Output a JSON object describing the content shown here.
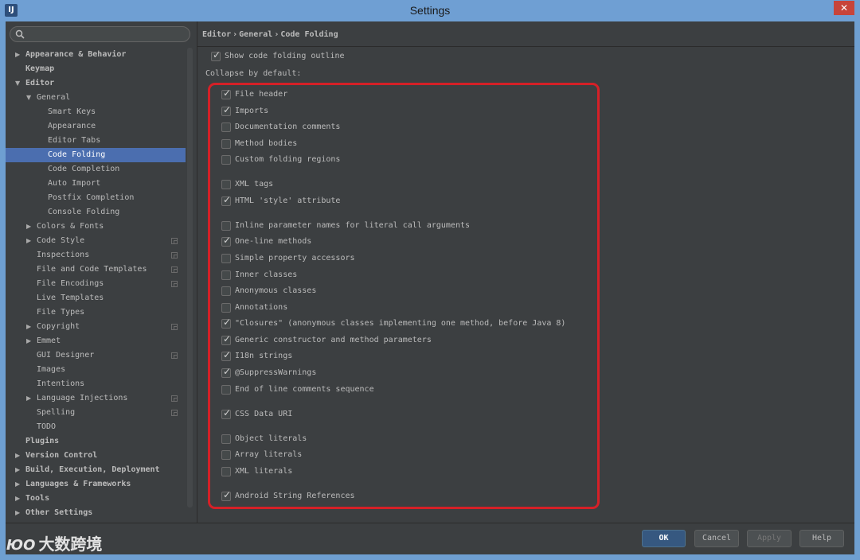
{
  "window": {
    "title": "Settings",
    "app_icon_text": "IJ",
    "close_glyph": "✕"
  },
  "search": {
    "placeholder": "",
    "value": ""
  },
  "sidebar": {
    "items": [
      {
        "label": "Appearance & Behavior",
        "level": 0,
        "arrow": "▶",
        "bold": true,
        "selected": false,
        "project": false
      },
      {
        "label": "Keymap",
        "level": 0,
        "arrow": "",
        "bold": true,
        "selected": false,
        "project": false
      },
      {
        "label": "Editor",
        "level": 0,
        "arrow": "▼",
        "bold": true,
        "selected": false,
        "project": false
      },
      {
        "label": "General",
        "level": 1,
        "arrow": "▼",
        "bold": false,
        "selected": false,
        "project": false
      },
      {
        "label": "Smart Keys",
        "level": 2,
        "arrow": "",
        "bold": false,
        "selected": false,
        "project": false
      },
      {
        "label": "Appearance",
        "level": 2,
        "arrow": "",
        "bold": false,
        "selected": false,
        "project": false
      },
      {
        "label": "Editor Tabs",
        "level": 2,
        "arrow": "",
        "bold": false,
        "selected": false,
        "project": false
      },
      {
        "label": "Code Folding",
        "level": 2,
        "arrow": "",
        "bold": false,
        "selected": true,
        "project": false
      },
      {
        "label": "Code Completion",
        "level": 2,
        "arrow": "",
        "bold": false,
        "selected": false,
        "project": false
      },
      {
        "label": "Auto Import",
        "level": 2,
        "arrow": "",
        "bold": false,
        "selected": false,
        "project": false
      },
      {
        "label": "Postfix Completion",
        "level": 2,
        "arrow": "",
        "bold": false,
        "selected": false,
        "project": false
      },
      {
        "label": "Console Folding",
        "level": 2,
        "arrow": "",
        "bold": false,
        "selected": false,
        "project": false
      },
      {
        "label": "Colors & Fonts",
        "level": 1,
        "arrow": "▶",
        "bold": false,
        "selected": false,
        "project": false
      },
      {
        "label": "Code Style",
        "level": 1,
        "arrow": "▶",
        "bold": false,
        "selected": false,
        "project": true
      },
      {
        "label": "Inspections",
        "level": 1,
        "arrow": "",
        "bold": false,
        "selected": false,
        "project": true
      },
      {
        "label": "File and Code Templates",
        "level": 1,
        "arrow": "",
        "bold": false,
        "selected": false,
        "project": true
      },
      {
        "label": "File Encodings",
        "level": 1,
        "arrow": "",
        "bold": false,
        "selected": false,
        "project": true
      },
      {
        "label": "Live Templates",
        "level": 1,
        "arrow": "",
        "bold": false,
        "selected": false,
        "project": false
      },
      {
        "label": "File Types",
        "level": 1,
        "arrow": "",
        "bold": false,
        "selected": false,
        "project": false
      },
      {
        "label": "Copyright",
        "level": 1,
        "arrow": "▶",
        "bold": false,
        "selected": false,
        "project": true
      },
      {
        "label": "Emmet",
        "level": 1,
        "arrow": "▶",
        "bold": false,
        "selected": false,
        "project": false
      },
      {
        "label": "GUI Designer",
        "level": 1,
        "arrow": "",
        "bold": false,
        "selected": false,
        "project": true
      },
      {
        "label": "Images",
        "level": 1,
        "arrow": "",
        "bold": false,
        "selected": false,
        "project": false
      },
      {
        "label": "Intentions",
        "level": 1,
        "arrow": "",
        "bold": false,
        "selected": false,
        "project": false
      },
      {
        "label": "Language Injections",
        "level": 1,
        "arrow": "▶",
        "bold": false,
        "selected": false,
        "project": true
      },
      {
        "label": "Spelling",
        "level": 1,
        "arrow": "",
        "bold": false,
        "selected": false,
        "project": true
      },
      {
        "label": "TODO",
        "level": 1,
        "arrow": "",
        "bold": false,
        "selected": false,
        "project": false
      },
      {
        "label": "Plugins",
        "level": 0,
        "arrow": "",
        "bold": true,
        "selected": false,
        "project": false
      },
      {
        "label": "Version Control",
        "level": 0,
        "arrow": "▶",
        "bold": true,
        "selected": false,
        "project": false
      },
      {
        "label": "Build, Execution, Deployment",
        "level": 0,
        "arrow": "▶",
        "bold": true,
        "selected": false,
        "project": false
      },
      {
        "label": "Languages & Frameworks",
        "level": 0,
        "arrow": "▶",
        "bold": true,
        "selected": false,
        "project": false
      },
      {
        "label": "Tools",
        "level": 0,
        "arrow": "▶",
        "bold": true,
        "selected": false,
        "project": false
      },
      {
        "label": "Other Settings",
        "level": 0,
        "arrow": "▶",
        "bold": true,
        "selected": false,
        "project": false
      }
    ]
  },
  "breadcrumb": {
    "parts": [
      "Editor",
      "General",
      "Code Folding"
    ],
    "separator": "›"
  },
  "content": {
    "show_outline": {
      "label": "Show code folding outline",
      "checked": true
    },
    "collapse_label": "Collapse by default:",
    "options": [
      {
        "label": "File header",
        "checked": true
      },
      {
        "label": "Imports",
        "checked": true
      },
      {
        "label": "Documentation comments",
        "checked": false
      },
      {
        "label": "Method bodies",
        "checked": false
      },
      {
        "label": "Custom folding regions",
        "checked": false
      },
      {
        "label": "XML tags",
        "checked": false
      },
      {
        "label": "HTML 'style' attribute",
        "checked": true
      },
      {
        "label": "Inline parameter names for literal call arguments",
        "checked": false
      },
      {
        "label": "One-line methods",
        "checked": true
      },
      {
        "label": "Simple property accessors",
        "checked": false
      },
      {
        "label": "Inner classes",
        "checked": false
      },
      {
        "label": "Anonymous classes",
        "checked": false
      },
      {
        "label": "Annotations",
        "checked": false
      },
      {
        "label": "\"Closures\" (anonymous classes implementing one method, before Java 8)",
        "checked": true
      },
      {
        "label": "Generic constructor and method parameters",
        "checked": true
      },
      {
        "label": "I18n strings",
        "checked": true
      },
      {
        "label": "@SuppressWarnings",
        "checked": true
      },
      {
        "label": "End of line comments sequence",
        "checked": false
      },
      {
        "label": "CSS Data URI",
        "checked": true
      },
      {
        "label": "Object literals",
        "checked": false
      },
      {
        "label": "Array literals",
        "checked": false
      },
      {
        "label": "XML literals",
        "checked": false
      },
      {
        "label": "Android String References",
        "checked": true
      }
    ]
  },
  "buttons": {
    "ok": "OK",
    "cancel": "Cancel",
    "apply": "Apply",
    "help": "Help"
  },
  "watermark": {
    "logo": "ЮO",
    "text": "大数跨境"
  },
  "colors": {
    "accent": "#4b6eaf",
    "highlight": "#d52027",
    "background": "#3c3f41"
  }
}
